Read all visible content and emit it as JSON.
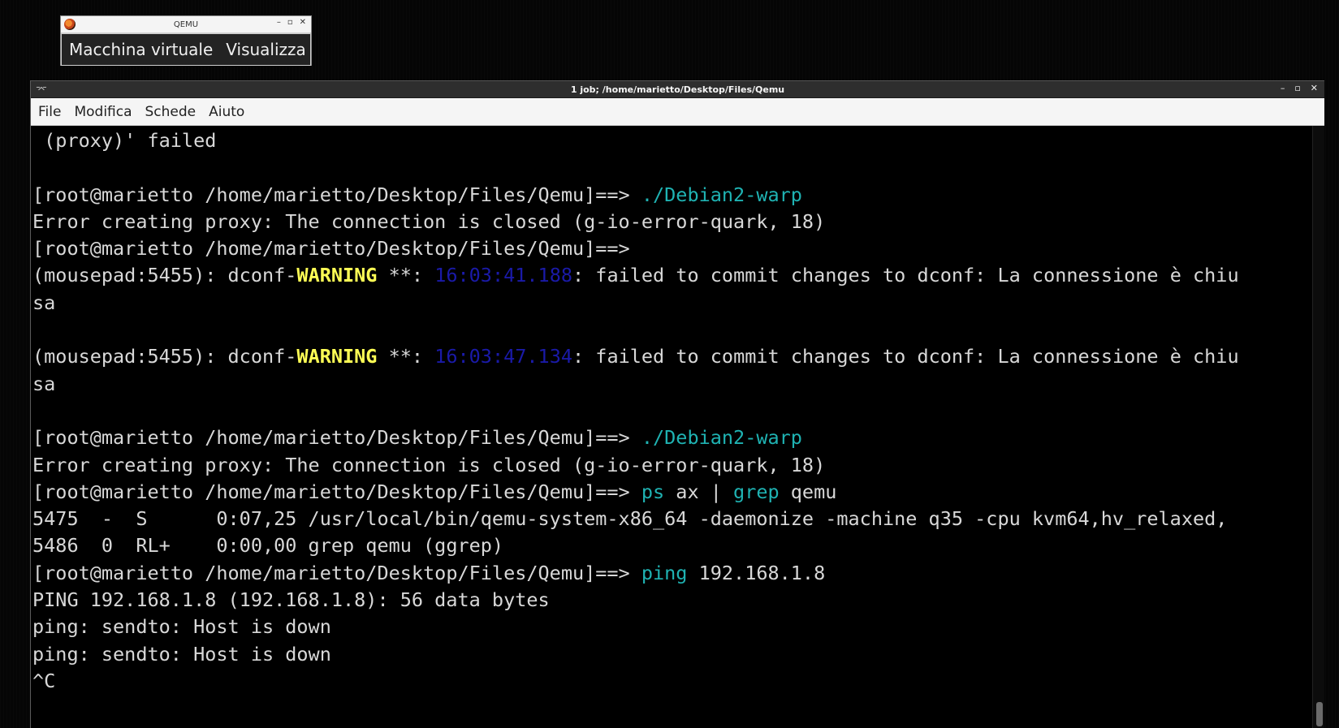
{
  "qemu": {
    "title": "QEMU",
    "menu": [
      "Macchina virtuale",
      "Visualizza"
    ]
  },
  "terminal": {
    "title": "1 job; /home/marietto/Desktop/Files/Qemu",
    "menu": [
      "File",
      "Modifica",
      "Schede",
      "Aiuto"
    ],
    "lines": [
      [
        {
          "t": " (proxy)' failed"
        }
      ],
      [],
      [
        {
          "t": "[root@marietto /home/marietto/Desktop/Files/Qemu]==> "
        },
        {
          "t": "./Debian2-warp",
          "c": "cmd"
        }
      ],
      [
        {
          "t": "Error creating proxy: The connection is closed (g-io-error-quark, 18)"
        }
      ],
      [
        {
          "t": "[root@marietto /home/marietto/Desktop/Files/Qemu]==> "
        }
      ],
      [
        {
          "t": "(mousepad:5455): dconf-"
        },
        {
          "t": "WARNING",
          "c": "warn"
        },
        {
          "t": " **: "
        },
        {
          "t": "16:03:41.188",
          "c": "ts"
        },
        {
          "t": ": failed to commit changes to dconf: La connessione è chiu"
        }
      ],
      [
        {
          "t": "sa"
        }
      ],
      [],
      [
        {
          "t": "(mousepad:5455): dconf-"
        },
        {
          "t": "WARNING",
          "c": "warn"
        },
        {
          "t": " **: "
        },
        {
          "t": "16:03:47.134",
          "c": "ts"
        },
        {
          "t": ": failed to commit changes to dconf: La connessione è chiu"
        }
      ],
      [
        {
          "t": "sa"
        }
      ],
      [],
      [
        {
          "t": "[root@marietto /home/marietto/Desktop/Files/Qemu]==> "
        },
        {
          "t": "./Debian2-warp",
          "c": "cmd"
        }
      ],
      [
        {
          "t": "Error creating proxy: The connection is closed (g-io-error-quark, 18)"
        }
      ],
      [
        {
          "t": "[root@marietto /home/marietto/Desktop/Files/Qemu]==> "
        },
        {
          "t": "ps",
          "c": "cmd"
        },
        {
          "t": " ax | "
        },
        {
          "t": "grep",
          "c": "cmd"
        },
        {
          "t": " qemu"
        }
      ],
      [
        {
          "t": "5475  -  S      0:07,25 /usr/local/bin/qemu-system-x86_64 -daemonize -machine q35 -cpu kvm64,hv_relaxed,"
        }
      ],
      [
        {
          "t": "5486  0  RL+    0:00,00 grep qemu (ggrep)"
        }
      ],
      [
        {
          "t": "[root@marietto /home/marietto/Desktop/Files/Qemu]==> "
        },
        {
          "t": "ping",
          "c": "cmd"
        },
        {
          "t": " 192.168.1.8"
        }
      ],
      [
        {
          "t": "PING 192.168.1.8 (192.168.1.8): 56 data bytes"
        }
      ],
      [
        {
          "t": "ping: sendto: Host is down"
        }
      ],
      [
        {
          "t": "ping: sendto: Host is down"
        }
      ],
      [
        {
          "t": "^C"
        }
      ]
    ]
  },
  "colors": {
    "command": "#1fb3b3",
    "warning": "#ffff55",
    "timestamp": "#1a1aa8"
  }
}
